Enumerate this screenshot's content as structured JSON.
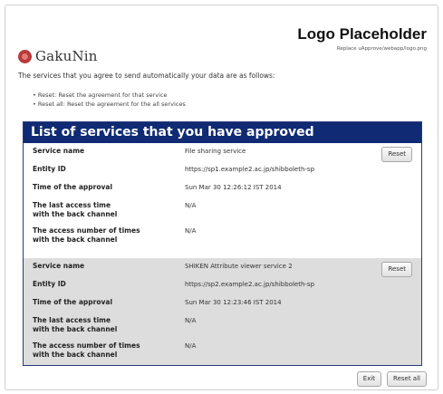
{
  "header": {
    "logo_title": "Logo Placeholder",
    "logo_subtitle": "Replace uApprove/webapp/logo.png",
    "brand": "GakuNin"
  },
  "intro": {
    "text": "The services that you agree to send automatically your data are as follows:",
    "bullets": [
      "Reset: Reset the agreement for that service",
      "Reset all: Reset the agreement for the all services"
    ]
  },
  "panel": {
    "title": "List of services that you have approved",
    "labels": {
      "service_name": "Service name",
      "entity_id": "Entity ID",
      "time_approval": "Time of the approval",
      "last_access_l1": "The last access time",
      "last_access_l2": "with the back channel",
      "access_num_l1": "The access number of times",
      "access_num_l2": "with the back channel"
    },
    "services": [
      {
        "name": "File sharing service",
        "entity_id": "https://sp1.example2.ac.jp/shibboleth-sp",
        "time": "Sun Mar 30 12:26:12 IST 2014",
        "last_access": "N/A",
        "access_count": "N/A",
        "reset_label": "Reset"
      },
      {
        "name": "SHIKEN Attribute viewer service 2",
        "entity_id": "https://sp2.example2.ac.jp/shibboleth-sp",
        "time": "Sun Mar 30 12:23:46 IST 2014",
        "last_access": "N/A",
        "access_count": "N/A",
        "reset_label": "Reset"
      }
    ]
  },
  "footer": {
    "exit_label": "Exit",
    "reset_all_label": "Reset all"
  },
  "colors": {
    "header_bg": "#102a73",
    "brand_mark": "#b73a3a",
    "row_alt_bg": "#dddddd"
  }
}
